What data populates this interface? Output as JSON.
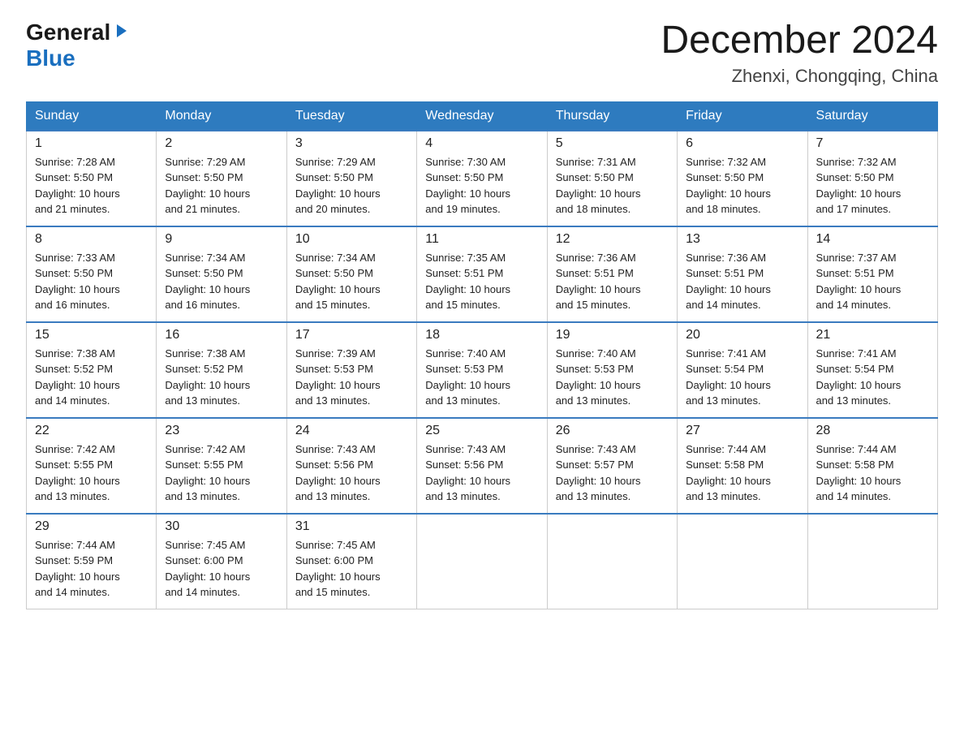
{
  "header": {
    "logo_general": "General",
    "logo_blue": "Blue",
    "title": "December 2024",
    "location": "Zhenxi, Chongqing, China"
  },
  "days_of_week": [
    "Sunday",
    "Monday",
    "Tuesday",
    "Wednesday",
    "Thursday",
    "Friday",
    "Saturday"
  ],
  "weeks": [
    [
      {
        "day": "1",
        "sunrise": "7:28 AM",
        "sunset": "5:50 PM",
        "daylight": "10 hours and 21 minutes."
      },
      {
        "day": "2",
        "sunrise": "7:29 AM",
        "sunset": "5:50 PM",
        "daylight": "10 hours and 21 minutes."
      },
      {
        "day": "3",
        "sunrise": "7:29 AM",
        "sunset": "5:50 PM",
        "daylight": "10 hours and 20 minutes."
      },
      {
        "day": "4",
        "sunrise": "7:30 AM",
        "sunset": "5:50 PM",
        "daylight": "10 hours and 19 minutes."
      },
      {
        "day": "5",
        "sunrise": "7:31 AM",
        "sunset": "5:50 PM",
        "daylight": "10 hours and 18 minutes."
      },
      {
        "day": "6",
        "sunrise": "7:32 AM",
        "sunset": "5:50 PM",
        "daylight": "10 hours and 18 minutes."
      },
      {
        "day": "7",
        "sunrise": "7:32 AM",
        "sunset": "5:50 PM",
        "daylight": "10 hours and 17 minutes."
      }
    ],
    [
      {
        "day": "8",
        "sunrise": "7:33 AM",
        "sunset": "5:50 PM",
        "daylight": "10 hours and 16 minutes."
      },
      {
        "day": "9",
        "sunrise": "7:34 AM",
        "sunset": "5:50 PM",
        "daylight": "10 hours and 16 minutes."
      },
      {
        "day": "10",
        "sunrise": "7:34 AM",
        "sunset": "5:50 PM",
        "daylight": "10 hours and 15 minutes."
      },
      {
        "day": "11",
        "sunrise": "7:35 AM",
        "sunset": "5:51 PM",
        "daylight": "10 hours and 15 minutes."
      },
      {
        "day": "12",
        "sunrise": "7:36 AM",
        "sunset": "5:51 PM",
        "daylight": "10 hours and 15 minutes."
      },
      {
        "day": "13",
        "sunrise": "7:36 AM",
        "sunset": "5:51 PM",
        "daylight": "10 hours and 14 minutes."
      },
      {
        "day": "14",
        "sunrise": "7:37 AM",
        "sunset": "5:51 PM",
        "daylight": "10 hours and 14 minutes."
      }
    ],
    [
      {
        "day": "15",
        "sunrise": "7:38 AM",
        "sunset": "5:52 PM",
        "daylight": "10 hours and 14 minutes."
      },
      {
        "day": "16",
        "sunrise": "7:38 AM",
        "sunset": "5:52 PM",
        "daylight": "10 hours and 13 minutes."
      },
      {
        "day": "17",
        "sunrise": "7:39 AM",
        "sunset": "5:53 PM",
        "daylight": "10 hours and 13 minutes."
      },
      {
        "day": "18",
        "sunrise": "7:40 AM",
        "sunset": "5:53 PM",
        "daylight": "10 hours and 13 minutes."
      },
      {
        "day": "19",
        "sunrise": "7:40 AM",
        "sunset": "5:53 PM",
        "daylight": "10 hours and 13 minutes."
      },
      {
        "day": "20",
        "sunrise": "7:41 AM",
        "sunset": "5:54 PM",
        "daylight": "10 hours and 13 minutes."
      },
      {
        "day": "21",
        "sunrise": "7:41 AM",
        "sunset": "5:54 PM",
        "daylight": "10 hours and 13 minutes."
      }
    ],
    [
      {
        "day": "22",
        "sunrise": "7:42 AM",
        "sunset": "5:55 PM",
        "daylight": "10 hours and 13 minutes."
      },
      {
        "day": "23",
        "sunrise": "7:42 AM",
        "sunset": "5:55 PM",
        "daylight": "10 hours and 13 minutes."
      },
      {
        "day": "24",
        "sunrise": "7:43 AM",
        "sunset": "5:56 PM",
        "daylight": "10 hours and 13 minutes."
      },
      {
        "day": "25",
        "sunrise": "7:43 AM",
        "sunset": "5:56 PM",
        "daylight": "10 hours and 13 minutes."
      },
      {
        "day": "26",
        "sunrise": "7:43 AM",
        "sunset": "5:57 PM",
        "daylight": "10 hours and 13 minutes."
      },
      {
        "day": "27",
        "sunrise": "7:44 AM",
        "sunset": "5:58 PM",
        "daylight": "10 hours and 13 minutes."
      },
      {
        "day": "28",
        "sunrise": "7:44 AM",
        "sunset": "5:58 PM",
        "daylight": "10 hours and 14 minutes."
      }
    ],
    [
      {
        "day": "29",
        "sunrise": "7:44 AM",
        "sunset": "5:59 PM",
        "daylight": "10 hours and 14 minutes."
      },
      {
        "day": "30",
        "sunrise": "7:45 AM",
        "sunset": "6:00 PM",
        "daylight": "10 hours and 14 minutes."
      },
      {
        "day": "31",
        "sunrise": "7:45 AM",
        "sunset": "6:00 PM",
        "daylight": "10 hours and 15 minutes."
      },
      null,
      null,
      null,
      null
    ]
  ],
  "labels": {
    "sunrise": "Sunrise:",
    "sunset": "Sunset:",
    "daylight": "Daylight:"
  }
}
